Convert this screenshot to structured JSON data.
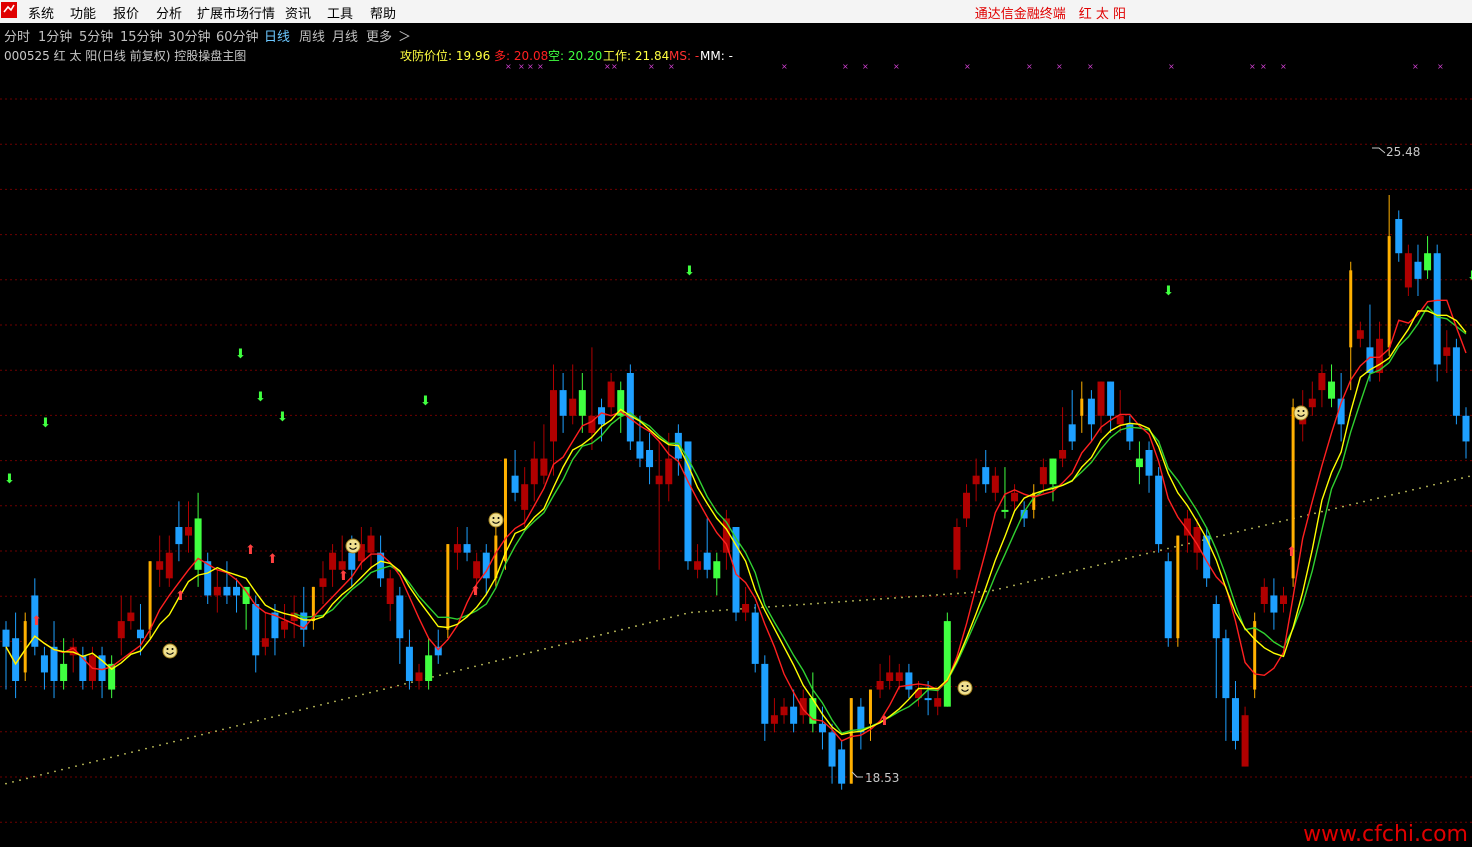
{
  "menubar": {
    "items": [
      "系统",
      "功能",
      "报价",
      "分析",
      "扩展市场行情",
      "资讯",
      "工具",
      "帮助"
    ],
    "brand": "通达信金融终端　红 太 阳"
  },
  "periods": {
    "items": [
      "分时",
      "1分钟",
      "5分钟",
      "15分钟",
      "30分钟",
      "60分钟",
      "日线",
      "周线",
      "月线",
      "更多",
      "＞"
    ],
    "active": "日线"
  },
  "indicator_header": {
    "title": "000525 红 太 阳(日线 前复权) 控股操盘主图",
    "attack_label": "攻防价位: 19.96",
    "long_label": "多: 20.08",
    "short_label": "空: 20.20",
    "work_label": "工作: 21.84",
    "ms_label": "MS: -",
    "mm_label": "MM: -"
  },
  "annotations": {
    "high_label": "25.48",
    "low_label": "18.53"
  },
  "watermark": "www.cfchi.com",
  "colors": {
    "up_bar": "#ffb000",
    "up_bar_strong": "#40ff40",
    "down_bar": "#1ea0ff",
    "red_bar": "#b00000",
    "ma_red": "#ff2020",
    "ma_yellow": "#ffff00",
    "ma_green": "#30d030",
    "dots": "#c8c860",
    "grid": "#6e0000"
  },
  "chart_data": {
    "type": "candlestick",
    "price_range": [
      18.0,
      27.0
    ],
    "high": 25.48,
    "low": 18.53,
    "candles": [
      {
        "o": 20.4,
        "c": 20.2,
        "h": 20.5,
        "l": 19.7,
        "col": "down"
      },
      {
        "o": 20.3,
        "c": 19.8,
        "h": 20.6,
        "l": 19.6,
        "col": "down"
      },
      {
        "o": 19.9,
        "c": 20.5,
        "h": 20.6,
        "l": 19.8,
        "col": "up"
      },
      {
        "o": 20.2,
        "c": 20.8,
        "h": 21.0,
        "l": 20.1,
        "col": "down"
      },
      {
        "o": 20.1,
        "c": 19.9,
        "h": 20.2,
        "l": 19.7,
        "col": "down"
      },
      {
        "o": 20.2,
        "c": 19.8,
        "h": 20.5,
        "l": 19.6,
        "col": "down"
      },
      {
        "o": 19.8,
        "c": 20.0,
        "h": 20.3,
        "l": 19.7,
        "col": "green"
      },
      {
        "o": 20.2,
        "c": 20.1,
        "h": 20.3,
        "l": 19.9,
        "col": "red"
      },
      {
        "o": 20.1,
        "c": 19.8,
        "h": 20.2,
        "l": 19.7,
        "col": "down"
      },
      {
        "o": 19.8,
        "c": 20.1,
        "h": 20.2,
        "l": 19.7,
        "col": "red"
      },
      {
        "o": 20.1,
        "c": 19.8,
        "h": 20.2,
        "l": 19.6,
        "col": "down"
      },
      {
        "o": 19.7,
        "c": 20.0,
        "h": 20.1,
        "l": 19.6,
        "col": "green"
      },
      {
        "o": 20.3,
        "c": 20.5,
        "h": 20.8,
        "l": 20.1,
        "col": "red"
      },
      {
        "o": 20.5,
        "c": 20.6,
        "h": 20.8,
        "l": 20.4,
        "col": "red"
      },
      {
        "o": 20.4,
        "c": 20.3,
        "h": 20.7,
        "l": 20.1,
        "col": "down"
      },
      {
        "o": 20.4,
        "c": 21.2,
        "h": 21.2,
        "l": 20.3,
        "col": "up"
      },
      {
        "o": 21.1,
        "c": 21.2,
        "h": 21.5,
        "l": 20.9,
        "col": "red"
      },
      {
        "o": 21.3,
        "c": 21.0,
        "h": 21.5,
        "l": 20.9,
        "col": "red"
      },
      {
        "o": 21.6,
        "c": 21.4,
        "h": 21.9,
        "l": 21.2,
        "col": "down"
      },
      {
        "o": 21.6,
        "c": 21.5,
        "h": 21.9,
        "l": 21.3,
        "col": "red"
      },
      {
        "o": 21.7,
        "c": 21.1,
        "h": 22.0,
        "l": 20.9,
        "col": "green"
      },
      {
        "o": 21.2,
        "c": 20.8,
        "h": 21.3,
        "l": 20.7,
        "col": "down"
      },
      {
        "o": 20.9,
        "c": 20.8,
        "h": 21.1,
        "l": 20.6,
        "col": "red"
      },
      {
        "o": 20.9,
        "c": 20.8,
        "h": 21.2,
        "l": 20.7,
        "col": "down"
      },
      {
        "o": 20.8,
        "c": 20.9,
        "h": 21.0,
        "l": 20.6,
        "col": "down"
      },
      {
        "o": 20.9,
        "c": 20.7,
        "h": 20.9,
        "l": 20.4,
        "col": "green"
      },
      {
        "o": 20.7,
        "c": 20.1,
        "h": 20.8,
        "l": 19.9,
        "col": "down"
      },
      {
        "o": 20.2,
        "c": 20.3,
        "h": 20.6,
        "l": 20.1,
        "col": "red"
      },
      {
        "o": 20.3,
        "c": 20.6,
        "h": 20.7,
        "l": 20.1,
        "col": "down"
      },
      {
        "o": 20.4,
        "c": 20.5,
        "h": 20.7,
        "l": 20.3,
        "col": "red"
      },
      {
        "o": 20.5,
        "c": 20.6,
        "h": 20.8,
        "l": 20.3,
        "col": "red"
      },
      {
        "o": 20.6,
        "c": 20.4,
        "h": 20.9,
        "l": 20.2,
        "col": "down"
      },
      {
        "o": 20.5,
        "c": 20.9,
        "h": 20.9,
        "l": 20.4,
        "col": "up"
      },
      {
        "o": 20.9,
        "c": 21.0,
        "h": 21.2,
        "l": 20.7,
        "col": "red"
      },
      {
        "o": 21.1,
        "c": 21.3,
        "h": 21.4,
        "l": 20.9,
        "col": "red"
      },
      {
        "o": 21.1,
        "c": 21.2,
        "h": 21.5,
        "l": 21.0,
        "col": "red"
      },
      {
        "o": 21.1,
        "c": 21.3,
        "h": 21.5,
        "l": 20.9,
        "col": "down"
      },
      {
        "o": 21.2,
        "c": 21.4,
        "h": 21.6,
        "l": 21.1,
        "col": "red"
      },
      {
        "o": 21.3,
        "c": 21.5,
        "h": 21.6,
        "l": 21.1,
        "col": "red"
      },
      {
        "o": 21.3,
        "c": 21.0,
        "h": 21.5,
        "l": 20.9,
        "col": "down"
      },
      {
        "o": 21.0,
        "c": 20.7,
        "h": 21.1,
        "l": 20.5,
        "col": "red"
      },
      {
        "o": 20.8,
        "c": 20.3,
        "h": 20.9,
        "l": 20.0,
        "col": "down"
      },
      {
        "o": 20.2,
        "c": 19.8,
        "h": 20.4,
        "l": 19.7,
        "col": "down"
      },
      {
        "o": 19.8,
        "c": 19.9,
        "h": 20.0,
        "l": 19.7,
        "col": "red"
      },
      {
        "o": 19.8,
        "c": 20.1,
        "h": 20.3,
        "l": 19.7,
        "col": "green"
      },
      {
        "o": 20.1,
        "c": 20.2,
        "h": 20.4,
        "l": 20.0,
        "col": "down"
      },
      {
        "o": 20.4,
        "c": 21.4,
        "h": 21.4,
        "l": 20.3,
        "col": "up"
      },
      {
        "o": 21.4,
        "c": 21.3,
        "h": 21.6,
        "l": 21.1,
        "col": "red"
      },
      {
        "o": 21.3,
        "c": 21.4,
        "h": 21.6,
        "l": 21.2,
        "col": "down"
      },
      {
        "o": 21.0,
        "c": 21.2,
        "h": 21.3,
        "l": 20.8,
        "col": "red"
      },
      {
        "o": 21.3,
        "c": 21.0,
        "h": 21.4,
        "l": 20.8,
        "col": "down"
      },
      {
        "o": 21.0,
        "c": 21.5,
        "h": 21.6,
        "l": 20.9,
        "col": "up"
      },
      {
        "o": 21.2,
        "c": 22.4,
        "h": 22.4,
        "l": 21.1,
        "col": "up"
      },
      {
        "o": 22.2,
        "c": 22.0,
        "h": 22.5,
        "l": 21.9,
        "col": "down"
      },
      {
        "o": 22.1,
        "c": 21.8,
        "h": 22.3,
        "l": 21.6,
        "col": "red"
      },
      {
        "o": 22.1,
        "c": 22.4,
        "h": 22.6,
        "l": 21.9,
        "col": "red"
      },
      {
        "o": 22.4,
        "c": 22.2,
        "h": 22.8,
        "l": 22.1,
        "col": "red"
      },
      {
        "o": 22.6,
        "c": 23.2,
        "h": 23.5,
        "l": 22.2,
        "col": "red"
      },
      {
        "o": 23.2,
        "c": 22.9,
        "h": 23.4,
        "l": 22.7,
        "col": "down"
      },
      {
        "o": 22.9,
        "c": 23.1,
        "h": 23.5,
        "l": 22.8,
        "col": "red"
      },
      {
        "o": 23.2,
        "c": 22.9,
        "h": 23.4,
        "l": 22.7,
        "col": "green"
      },
      {
        "o": 22.9,
        "c": 22.7,
        "h": 23.7,
        "l": 22.5,
        "col": "red"
      },
      {
        "o": 23.0,
        "c": 22.8,
        "h": 23.1,
        "l": 22.6,
        "col": "down"
      },
      {
        "o": 23.3,
        "c": 23.0,
        "h": 23.4,
        "l": 22.9,
        "col": "red"
      },
      {
        "o": 22.9,
        "c": 23.2,
        "h": 23.3,
        "l": 22.7,
        "col": "green"
      },
      {
        "o": 23.4,
        "c": 22.6,
        "h": 23.5,
        "l": 22.5,
        "col": "down"
      },
      {
        "o": 22.6,
        "c": 22.4,
        "h": 22.9,
        "l": 22.3,
        "col": "down"
      },
      {
        "o": 22.5,
        "c": 22.3,
        "h": 22.7,
        "l": 22.1,
        "col": "down"
      },
      {
        "o": 22.2,
        "c": 22.1,
        "h": 22.6,
        "l": 21.1,
        "col": "red"
      },
      {
        "o": 22.4,
        "c": 22.1,
        "h": 22.7,
        "l": 21.9,
        "col": "red"
      },
      {
        "o": 22.4,
        "c": 22.7,
        "h": 22.8,
        "l": 22.2,
        "col": "down"
      },
      {
        "o": 22.6,
        "c": 21.2,
        "h": 22.6,
        "l": 21.1,
        "col": "down"
      },
      {
        "o": 21.2,
        "c": 21.1,
        "h": 21.4,
        "l": 21.0,
        "col": "red"
      },
      {
        "o": 21.3,
        "c": 21.1,
        "h": 21.7,
        "l": 21.0,
        "col": "down"
      },
      {
        "o": 21.2,
        "c": 21.0,
        "h": 21.3,
        "l": 20.8,
        "col": "green"
      },
      {
        "o": 21.7,
        "c": 21.3,
        "h": 21.8,
        "l": 21.1,
        "col": "red"
      },
      {
        "o": 21.6,
        "c": 20.6,
        "h": 21.6,
        "l": 20.5,
        "col": "down"
      },
      {
        "o": 20.7,
        "c": 20.6,
        "h": 20.9,
        "l": 20.5,
        "col": "red"
      },
      {
        "o": 20.6,
        "c": 20.0,
        "h": 20.7,
        "l": 19.9,
        "col": "down"
      },
      {
        "o": 20.0,
        "c": 19.3,
        "h": 20.1,
        "l": 19.1,
        "col": "down"
      },
      {
        "o": 19.3,
        "c": 19.4,
        "h": 19.6,
        "l": 19.2,
        "col": "red"
      },
      {
        "o": 19.5,
        "c": 19.4,
        "h": 19.6,
        "l": 19.3,
        "col": "red"
      },
      {
        "o": 19.5,
        "c": 19.3,
        "h": 19.7,
        "l": 19.2,
        "col": "down"
      },
      {
        "o": 19.6,
        "c": 19.4,
        "h": 19.7,
        "l": 19.3,
        "col": "red"
      },
      {
        "o": 19.6,
        "c": 19.3,
        "h": 19.9,
        "l": 19.2,
        "col": "green"
      },
      {
        "o": 19.3,
        "c": 19.2,
        "h": 19.5,
        "l": 19.0,
        "col": "down"
      },
      {
        "o": 19.2,
        "c": 18.8,
        "h": 19.3,
        "l": 18.6,
        "col": "down"
      },
      {
        "o": 19.0,
        "c": 18.6,
        "h": 19.1,
        "l": 18.53,
        "col": "down"
      },
      {
        "o": 18.6,
        "c": 19.6,
        "h": 19.6,
        "l": 18.6,
        "col": "up"
      },
      {
        "o": 19.2,
        "c": 19.5,
        "h": 19.6,
        "l": 19.0,
        "col": "down"
      },
      {
        "o": 19.3,
        "c": 19.7,
        "h": 19.7,
        "l": 19.1,
        "col": "up"
      },
      {
        "o": 19.7,
        "c": 19.8,
        "h": 20.0,
        "l": 19.6,
        "col": "red"
      },
      {
        "o": 19.8,
        "c": 19.9,
        "h": 20.1,
        "l": 19.7,
        "col": "red"
      },
      {
        "o": 19.8,
        "c": 19.9,
        "h": 20.0,
        "l": 19.7,
        "col": "red"
      },
      {
        "o": 19.9,
        "c": 19.7,
        "h": 20.0,
        "l": 19.6,
        "col": "down"
      },
      {
        "o": 19.7,
        "c": 19.6,
        "h": 19.8,
        "l": 19.5,
        "col": "red"
      },
      {
        "o": 19.6,
        "c": 19.6,
        "h": 19.8,
        "l": 19.4,
        "col": "down"
      },
      {
        "o": 19.6,
        "c": 19.5,
        "h": 19.7,
        "l": 19.4,
        "col": "red"
      },
      {
        "o": 19.5,
        "c": 20.5,
        "h": 20.6,
        "l": 19.5,
        "col": "green"
      },
      {
        "o": 21.1,
        "c": 21.6,
        "h": 21.7,
        "l": 21.0,
        "col": "red"
      },
      {
        "o": 21.7,
        "c": 22.0,
        "h": 22.1,
        "l": 21.6,
        "col": "red"
      },
      {
        "o": 22.1,
        "c": 22.2,
        "h": 22.4,
        "l": 21.9,
        "col": "red"
      },
      {
        "o": 22.3,
        "c": 22.1,
        "h": 22.5,
        "l": 22.0,
        "col": "down"
      },
      {
        "o": 22.0,
        "c": 22.2,
        "h": 22.3,
        "l": 21.9,
        "col": "red"
      },
      {
        "o": 21.8,
        "c": 21.8,
        "h": 22.3,
        "l": 21.7,
        "col": "green"
      },
      {
        "o": 22.0,
        "c": 21.9,
        "h": 22.1,
        "l": 21.8,
        "col": "red"
      },
      {
        "o": 21.8,
        "c": 21.7,
        "h": 21.9,
        "l": 21.6,
        "col": "down"
      },
      {
        "o": 21.8,
        "c": 22.0,
        "h": 22.1,
        "l": 21.7,
        "col": "up"
      },
      {
        "o": 22.1,
        "c": 22.3,
        "h": 22.4,
        "l": 22.0,
        "col": "red"
      },
      {
        "o": 22.1,
        "c": 22.4,
        "h": 22.4,
        "l": 21.9,
        "col": "green"
      },
      {
        "o": 22.5,
        "c": 22.4,
        "h": 23.0,
        "l": 22.3,
        "col": "red"
      },
      {
        "o": 22.8,
        "c": 22.6,
        "h": 23.2,
        "l": 22.5,
        "col": "down"
      },
      {
        "o": 22.9,
        "c": 23.1,
        "h": 23.3,
        "l": 22.7,
        "col": "up"
      },
      {
        "o": 23.1,
        "c": 22.8,
        "h": 23.2,
        "l": 22.6,
        "col": "down"
      },
      {
        "o": 22.9,
        "c": 23.3,
        "h": 23.3,
        "l": 22.7,
        "col": "red"
      },
      {
        "o": 23.3,
        "c": 22.9,
        "h": 23.3,
        "l": 22.7,
        "col": "down"
      },
      {
        "o": 22.9,
        "c": 22.8,
        "h": 23.2,
        "l": 22.7,
        "col": "red"
      },
      {
        "o": 22.8,
        "c": 22.6,
        "h": 22.9,
        "l": 22.5,
        "col": "down"
      },
      {
        "o": 22.4,
        "c": 22.3,
        "h": 22.6,
        "l": 22.1,
        "col": "green"
      },
      {
        "o": 22.5,
        "c": 22.2,
        "h": 22.6,
        "l": 22.0,
        "col": "down"
      },
      {
        "o": 22.2,
        "c": 21.4,
        "h": 22.3,
        "l": 21.3,
        "col": "down"
      },
      {
        "o": 21.2,
        "c": 20.3,
        "h": 21.3,
        "l": 20.2,
        "col": "down"
      },
      {
        "o": 20.3,
        "c": 21.5,
        "h": 21.5,
        "l": 20.2,
        "col": "up"
      },
      {
        "o": 21.5,
        "c": 21.7,
        "h": 21.8,
        "l": 21.3,
        "col": "red"
      },
      {
        "o": 21.6,
        "c": 21.3,
        "h": 21.7,
        "l": 21.1,
        "col": "red"
      },
      {
        "o": 21.5,
        "c": 21.0,
        "h": 21.6,
        "l": 20.9,
        "col": "down"
      },
      {
        "o": 20.7,
        "c": 20.3,
        "h": 20.8,
        "l": 19.6,
        "col": "down"
      },
      {
        "o": 20.3,
        "c": 19.6,
        "h": 20.4,
        "l": 19.1,
        "col": "down"
      },
      {
        "o": 19.6,
        "c": 19.1,
        "h": 19.8,
        "l": 19.0,
        "col": "down"
      },
      {
        "o": 19.4,
        "c": 18.8,
        "h": 19.5,
        "l": 18.8,
        "col": "red"
      },
      {
        "o": 19.7,
        "c": 20.5,
        "h": 20.6,
        "l": 19.6,
        "col": "up"
      },
      {
        "o": 20.7,
        "c": 20.9,
        "h": 21.0,
        "l": 20.6,
        "col": "red"
      },
      {
        "o": 20.6,
        "c": 20.8,
        "h": 21.0,
        "l": 20.4,
        "col": "down"
      },
      {
        "o": 20.8,
        "c": 20.7,
        "h": 20.9,
        "l": 20.6,
        "col": "red"
      },
      {
        "o": 21.0,
        "c": 23.0,
        "h": 23.1,
        "l": 20.9,
        "col": "up"
      },
      {
        "o": 22.8,
        "c": 22.9,
        "h": 23.2,
        "l": 22.6,
        "col": "red"
      },
      {
        "o": 23.0,
        "c": 23.1,
        "h": 23.3,
        "l": 22.9,
        "col": "red"
      },
      {
        "o": 23.2,
        "c": 23.4,
        "h": 23.5,
        "l": 23.0,
        "col": "red"
      },
      {
        "o": 23.3,
        "c": 23.1,
        "h": 23.5,
        "l": 23.0,
        "col": "green"
      },
      {
        "o": 23.1,
        "c": 22.8,
        "h": 23.4,
        "l": 22.6,
        "col": "down"
      },
      {
        "o": 23.7,
        "c": 24.6,
        "h": 24.7,
        "l": 23.2,
        "col": "up"
      },
      {
        "o": 23.8,
        "c": 23.9,
        "h": 24.0,
        "l": 23.7,
        "col": "red"
      },
      {
        "o": 23.4,
        "c": 23.7,
        "h": 24.2,
        "l": 23.3,
        "col": "down"
      },
      {
        "o": 23.8,
        "c": 23.4,
        "h": 24.0,
        "l": 23.3,
        "col": "red"
      },
      {
        "o": 25.0,
        "c": 23.7,
        "h": 25.48,
        "l": 23.6,
        "col": "up"
      },
      {
        "o": 25.2,
        "c": 24.8,
        "h": 25.3,
        "l": 24.7,
        "col": "down"
      },
      {
        "o": 24.8,
        "c": 24.4,
        "h": 24.9,
        "l": 24.3,
        "col": "red"
      },
      {
        "o": 24.7,
        "c": 24.5,
        "h": 24.9,
        "l": 24.3,
        "col": "down"
      },
      {
        "o": 24.8,
        "c": 24.6,
        "h": 25.0,
        "l": 24.5,
        "col": "green"
      },
      {
        "o": 24.8,
        "c": 23.5,
        "h": 24.9,
        "l": 23.3,
        "col": "down"
      },
      {
        "o": 23.6,
        "c": 23.7,
        "h": 23.9,
        "l": 23.4,
        "col": "red"
      },
      {
        "o": 23.7,
        "c": 22.9,
        "h": 23.8,
        "l": 22.8,
        "col": "down"
      },
      {
        "o": 22.9,
        "c": 22.6,
        "h": 23.0,
        "l": 22.4,
        "col": "down"
      }
    ]
  }
}
